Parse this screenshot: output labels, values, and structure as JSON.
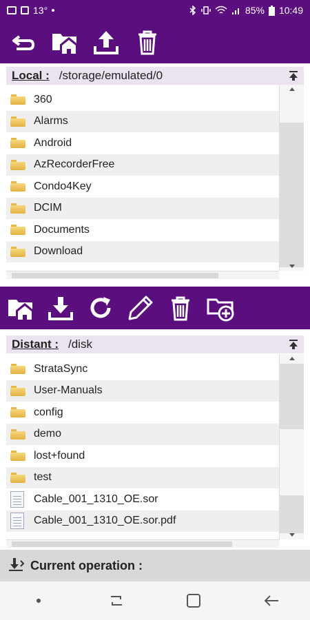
{
  "status_bar": {
    "temperature": "13°",
    "battery": "85%",
    "time": "10:49"
  },
  "local": {
    "label": "Local :",
    "path": "/storage/emulated/0",
    "items": [
      {
        "name": "360",
        "type": "folder"
      },
      {
        "name": "Alarms",
        "type": "folder"
      },
      {
        "name": "Android",
        "type": "folder"
      },
      {
        "name": "AzRecorderFree",
        "type": "folder"
      },
      {
        "name": "Condo4Key",
        "type": "folder"
      },
      {
        "name": "DCIM",
        "type": "folder"
      },
      {
        "name": "Documents",
        "type": "folder"
      },
      {
        "name": "Download",
        "type": "folder"
      }
    ]
  },
  "distant": {
    "label": "Distant :",
    "path": "/disk",
    "items": [
      {
        "name": "StrataSync",
        "type": "folder"
      },
      {
        "name": "User-Manuals",
        "type": "folder"
      },
      {
        "name": "config",
        "type": "folder"
      },
      {
        "name": "demo",
        "type": "folder"
      },
      {
        "name": "lost+found",
        "type": "folder"
      },
      {
        "name": "test",
        "type": "folder"
      },
      {
        "name": "Cable_001_1310_OE.sor",
        "type": "file"
      },
      {
        "name": "Cable_001_1310_OE.sor.pdf",
        "type": "file"
      }
    ]
  },
  "current_operation": {
    "label": "Current operation :"
  },
  "colors": {
    "toolbar": "#5b0f7e",
    "header": "#ece3f0"
  },
  "icons": {
    "top_toolbar": [
      "back-icon",
      "home-folder-icon",
      "upload-icon",
      "trash-icon"
    ],
    "mid_toolbar": [
      "home-folder-icon",
      "download-icon",
      "refresh-icon",
      "pencil-icon",
      "trash-icon",
      "new-folder-icon"
    ]
  }
}
